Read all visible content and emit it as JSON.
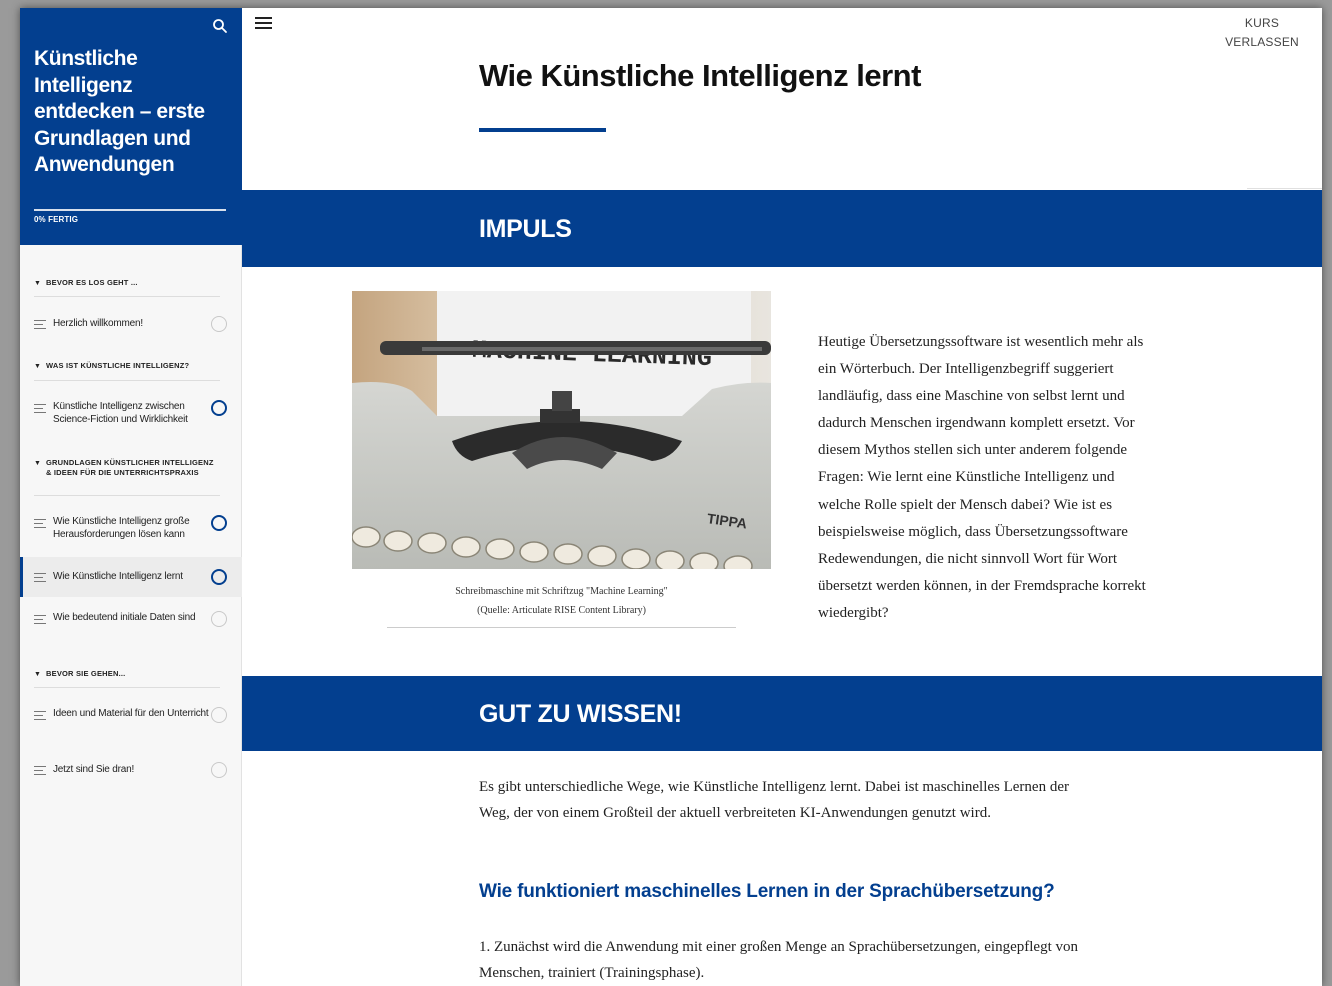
{
  "sidebar": {
    "course_title": "Künstliche Intelligenz entdecken – erste Grundlagen und Anwendungen",
    "progress_text": "0% FERTIG",
    "sections": [
      {
        "title": "BEVOR ES LOS GEHT ..."
      },
      {
        "title": "WAS IST KÜNSTLICHE INTELLIGENZ?"
      },
      {
        "title": "GRUNDLAGEN KÜNSTLICHER INTELLIGENZ & IDEEN FÜR DIE UNTERRICHTSPRAXIS"
      },
      {
        "title": "BEVOR SIE GEHEN..."
      }
    ],
    "lessons": [
      {
        "label": "Herzlich willkommen!",
        "status": "not-started"
      },
      {
        "label": "Künstliche Intelligenz zwischen Science-Fiction und Wirklichkeit",
        "status": "in-progress"
      },
      {
        "label": "Wie Künstliche Intelligenz große Herausforderungen lösen kann",
        "status": "in-progress"
      },
      {
        "label": "Wie Künstliche Intelligenz lernt",
        "status": "in-progress"
      },
      {
        "label": "Wie bedeutend initiale Daten sind",
        "status": "not-started"
      },
      {
        "label": "Ideen und Material für den Unterricht",
        "status": "not-started"
      },
      {
        "label": "Jetzt sind Sie dran!",
        "status": "not-started"
      }
    ]
  },
  "header": {
    "exit_label": "KURS VERLASSEN"
  },
  "main": {
    "title": "Wie Künstliche Intelligenz lernt",
    "impuls": {
      "heading": "IMPULS",
      "image_text": "MACHINE LEARNING",
      "image_brand": "TIPPA",
      "caption_line1": "Schreibmaschine mit Schriftzug \"Machine Learning\"",
      "caption_line2": "(Quelle: Articulate RISE Content Library)",
      "text": "Heutige Übersetzungssoftware ist wesentlich mehr als ein Wörterbuch. Der Intelligenzbegriff suggeriert landläufig, dass eine Maschine von selbst lernt und dadurch Menschen irgendwann komplett ersetzt. Vor diesem Mythos stellen sich unter anderem folgende Fragen: Wie lernt eine Künstliche Intelligenz und welche Rolle spielt der Mensch dabei? Wie ist es beispielsweise möglich, dass Übersetzungssoftware Redewendungen, die nicht sinnvoll Wort für Wort übersetzt werden können, in der Fremdsprache korrekt wiedergibt?"
    },
    "gut_zu_wissen": {
      "heading": "GUT ZU WISSEN!",
      "text": "Es gibt unterschiedliche Wege, wie Künstliche Intelligenz lernt. Dabei ist maschinelles Lernen der Weg, der von einem Großteil der aktuell verbreiteten KI-Anwendungen genutzt wird.",
      "subheading": "Wie funktioniert maschinelles Lernen in der Sprachübersetzung?",
      "list_text": "1. Zunächst wird die Anwendung mit einer großen Menge an Sprachübersetzungen, eingepflegt von Menschen, trainiert (Trainingsphase)."
    }
  },
  "colors": {
    "brand": "#033f8f",
    "sidebar_bg": "#f7f7f7"
  }
}
